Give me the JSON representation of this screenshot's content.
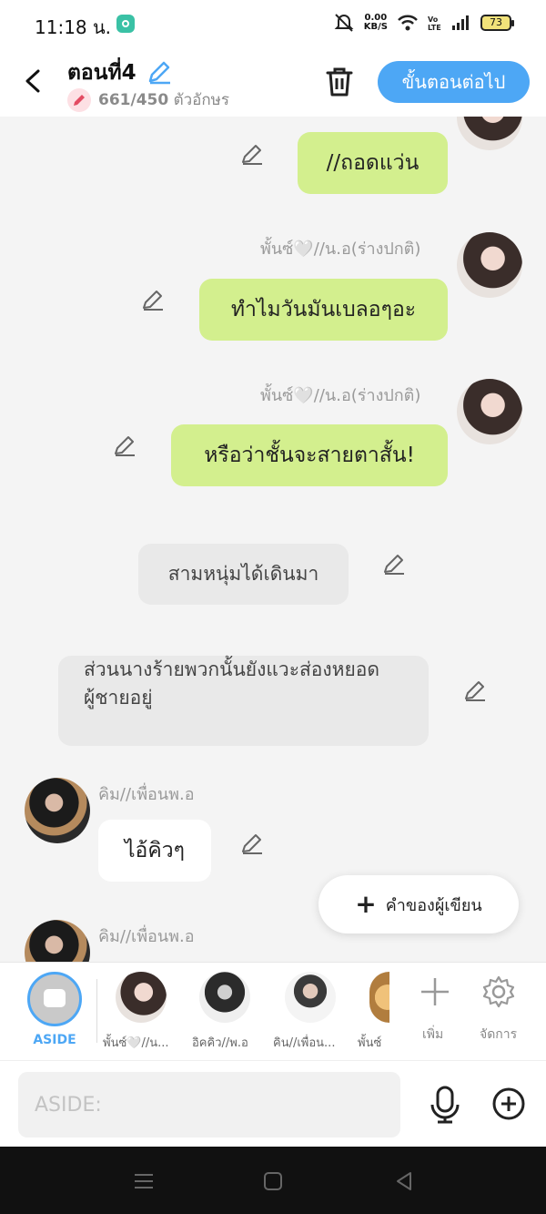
{
  "status": {
    "time": "11:18 น.",
    "speed_value": "0.00",
    "speed_unit": "KB/S",
    "battery": "73"
  },
  "header": {
    "title": "ตอนที่4",
    "char_count": "661/450",
    "char_unit": "ตัวอักษร",
    "next_label": "ขั้นตอนต่อไป"
  },
  "chat": {
    "messages": [
      {
        "text": "//ถอดแว่น"
      },
      {
        "name": "พั้นซ์🤍//น.อ(ร่างปกติ)",
        "text": "ทำไมวันมันเบลอๆอะ"
      },
      {
        "name": "พั้นซ์🤍//น.อ(ร่างปกติ)",
        "text": "หรือว่าชั้นจะสายตาสั้น!"
      },
      {
        "text": "สามหนุ่มได้เดินมา"
      },
      {
        "text_line1": "ส่วนนางร้ายพวกนั้นยังแวะส่องหยอด",
        "text_line2": "ผู้ชายอยู่"
      },
      {
        "name": "คิม//เพื่อนพ.อ",
        "text": "ไอ้คิวๆ"
      },
      {
        "name": "คิม//เพื่อนพ.อ"
      }
    ],
    "writer_button": "คำของผู้เขียน"
  },
  "charbar": {
    "aside_label": "ASIDE",
    "characters": [
      {
        "label": "พั้นซ์🤍//น..."
      },
      {
        "label": "อิคคิว//พ.อ"
      },
      {
        "label": "คิน//เพื่อน..."
      },
      {
        "label": "พั้นซ์"
      }
    ],
    "add_label": "เพิ่ม",
    "manage_label": "จัดการ"
  },
  "input": {
    "placeholder": "ASIDE:"
  }
}
